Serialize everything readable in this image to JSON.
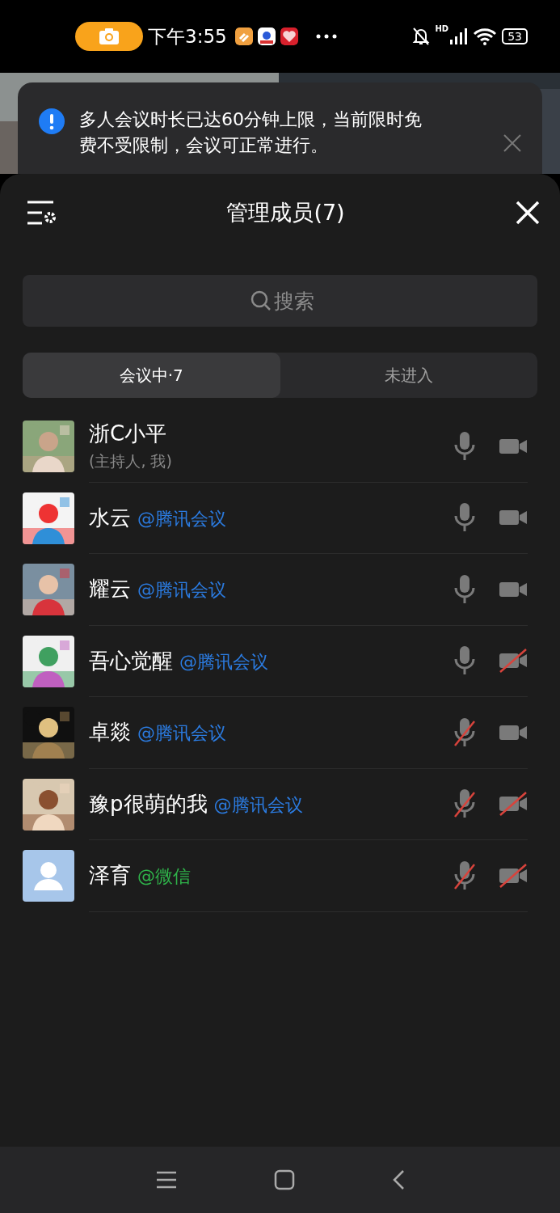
{
  "status_bar": {
    "time": "下午3:55",
    "network": "HD",
    "battery": "53"
  },
  "notice": {
    "text": "多人会议时长已达60分钟上限，当前限时免费不受限制，会议可正常进行。"
  },
  "panel": {
    "title": "管理成员(7)",
    "search": {
      "placeholder": "搜索"
    },
    "tabs": [
      {
        "label": "会议中·7",
        "selected": true
      },
      {
        "label": "未进入",
        "selected": false
      }
    ],
    "members": [
      {
        "name": "浙C小平",
        "subtitle": "(主持人, 我)",
        "mic_muted": false,
        "video_muted": false
      },
      {
        "name": "水云",
        "source": "@腾讯会议",
        "color": "#2b7be0",
        "mic_muted": false,
        "video_muted": false
      },
      {
        "name": "耀云",
        "source": "@腾讯会议",
        "color": "#2b7be0",
        "mic_muted": false,
        "video_muted": false
      },
      {
        "name": "吾心觉醒",
        "source": "@腾讯会议",
        "color": "#2b7be0",
        "mic_muted": false,
        "video_muted": true
      },
      {
        "name": "卓燚",
        "source": "@腾讯会议",
        "color": "#2b7be0",
        "mic_muted": true,
        "video_muted": false
      },
      {
        "name": "豫p很萌的我",
        "source": "@腾讯会议",
        "color": "#2b7be0",
        "mic_muted": true,
        "video_muted": true
      },
      {
        "name": "泽育",
        "kind": "default",
        "source": "@微信",
        "color": "#2fb34a",
        "mic_muted": true,
        "video_muted": true
      }
    ]
  }
}
